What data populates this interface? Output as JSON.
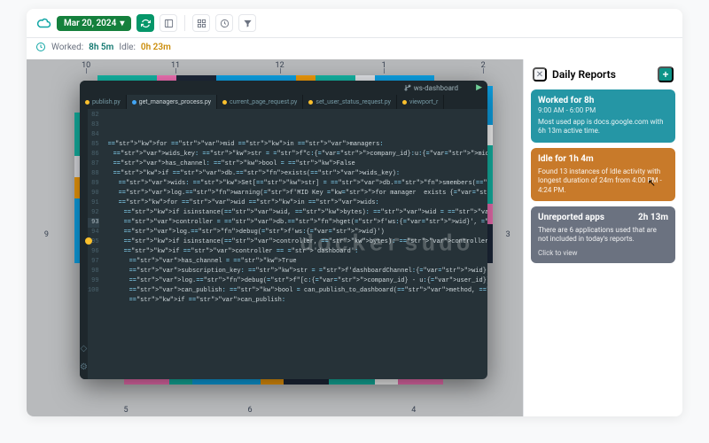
{
  "toolbar": {
    "date": "Mar 20, 2024"
  },
  "status": {
    "worked_label": "Worked:",
    "worked_value": "8h 5m",
    "idle_label": "Idle:",
    "idle_value": "0h 23m"
  },
  "timeline": {
    "hours_top": [
      "10",
      "11",
      "12",
      "1",
      "2"
    ],
    "hours_bottom": [
      "5",
      "6",
      "4"
    ],
    "hours_side": [
      "9",
      "3"
    ]
  },
  "editor": {
    "project_branch": "ws-dashboard",
    "tabs": [
      {
        "label": "publish.py",
        "active": false
      },
      {
        "label": "get_managers_process.py",
        "active": true
      },
      {
        "label": "current_page_request.py",
        "active": false
      },
      {
        "label": "set_user_status_request.py",
        "active": false
      },
      {
        "label": "viewport_r",
        "active": false
      }
    ],
    "line_start": 82,
    "highlight_line": 93,
    "code_lines": [
      "for mid in managers:",
      "  wids_key: str = f\"c:{company_id}:u:{mid}:ws\"",
      "",
      "  has_channel: bool = False",
      "  if db.exists(wids_key):",
      "    wids: Set[str] = db.smembers(wids_key)",
      "    log.warning(f'MID Key for manager  exists {wids_key} - {wids}')",
      "    for wid in wids:",
      "      if isinstance(wid, bytes): wid = wid.decode()",
      "      controller = db.hget(f'ws:{wid}', 'controller')",
      "      log.debug(f'ws:{wid}')",
      "",
      "      if isinstance(controller, bytes): controller = controller.decode()",
      "      if controller == 'dashboard':",
      "        has_channel = True",
      "        subscription_key: str = f'dashboardChannel:{wid}'",
      "        log.debug(f\"[c:{company_id} - u:{user_id}] Publishing data to {subscription",
      "        can_publish: bool = can_publish_to_dashboard(method, wid, company_id, user_",
      "        if can_publish:"
    ],
    "watermark": "dockersudo"
  },
  "panel": {
    "title": "Daily Reports",
    "cards": [
      {
        "tone": "teal",
        "title": "Worked for 8h",
        "subtitle": "9:00 AM - 6:00 PM",
        "body": "Most used app is docs.google.com with 6h 13m active time."
      },
      {
        "tone": "orange",
        "title": "Idle for 1h 4m",
        "body": "Found 13 instances of Idle activity with longest duration of 24m from 4:00 PM - 4:24 PM."
      },
      {
        "tone": "grey",
        "title": "Unreported apps",
        "right": "2h 13m",
        "body": "There are 6 applications used that are not included in today's reports.",
        "cta": "Click to view"
      }
    ]
  }
}
